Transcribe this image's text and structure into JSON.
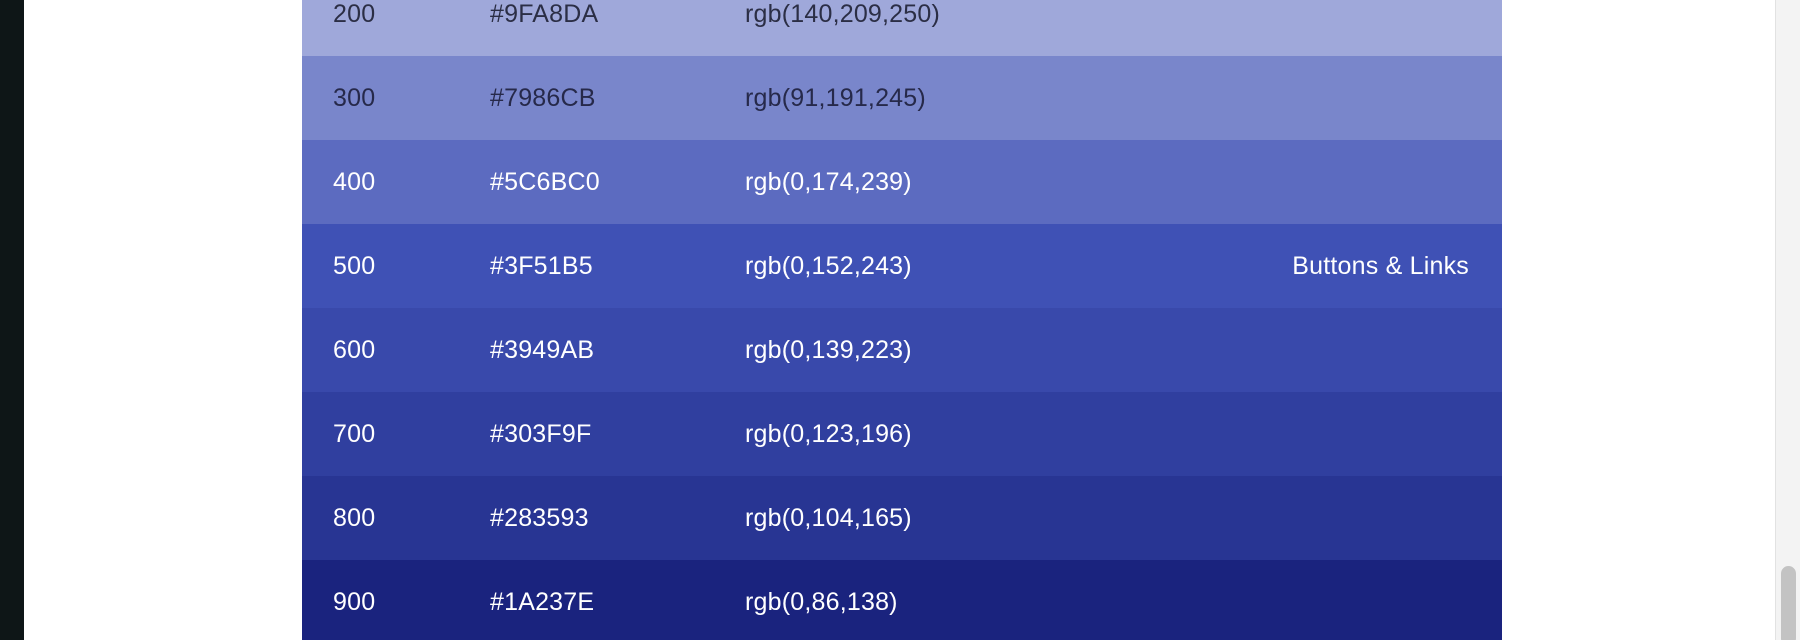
{
  "palette": {
    "rows": [
      {
        "shade": "200",
        "hex": "#9FA8DA",
        "rgb": "rgb(140,209,250)",
        "usage": "",
        "bg": "#9FA8DA",
        "fg": "#2b2e45"
      },
      {
        "shade": "300",
        "hex": "#7986CB",
        "rgb": "rgb(91,191,245)",
        "usage": "",
        "bg": "#7986CB",
        "fg": "#26294a"
      },
      {
        "shade": "400",
        "hex": "#5C6BC0",
        "rgb": "rgb(0,174,239)",
        "usage": "",
        "bg": "#5C6BC0",
        "fg": "#ffffff"
      },
      {
        "shade": "500",
        "hex": "#3F51B5",
        "rgb": "rgb(0,152,243)",
        "usage": "Buttons & Links",
        "bg": "#3F51B5",
        "fg": "#ffffff"
      },
      {
        "shade": "600",
        "hex": "#3949AB",
        "rgb": "rgb(0,139,223)",
        "usage": "",
        "bg": "#3949AB",
        "fg": "#ffffff"
      },
      {
        "shade": "700",
        "hex": "#303F9F",
        "rgb": "rgb(0,123,196)",
        "usage": "",
        "bg": "#303F9F",
        "fg": "#ffffff"
      },
      {
        "shade": "800",
        "hex": "#283593",
        "rgb": "rgb(0,104,165)",
        "usage": "",
        "bg": "#283593",
        "fg": "#ffffff"
      },
      {
        "shade": "900",
        "hex": "#1A237E",
        "rgb": "rgb(0,86,138)",
        "usage": "",
        "bg": "#1A237E",
        "fg": "#ffffff"
      }
    ]
  }
}
